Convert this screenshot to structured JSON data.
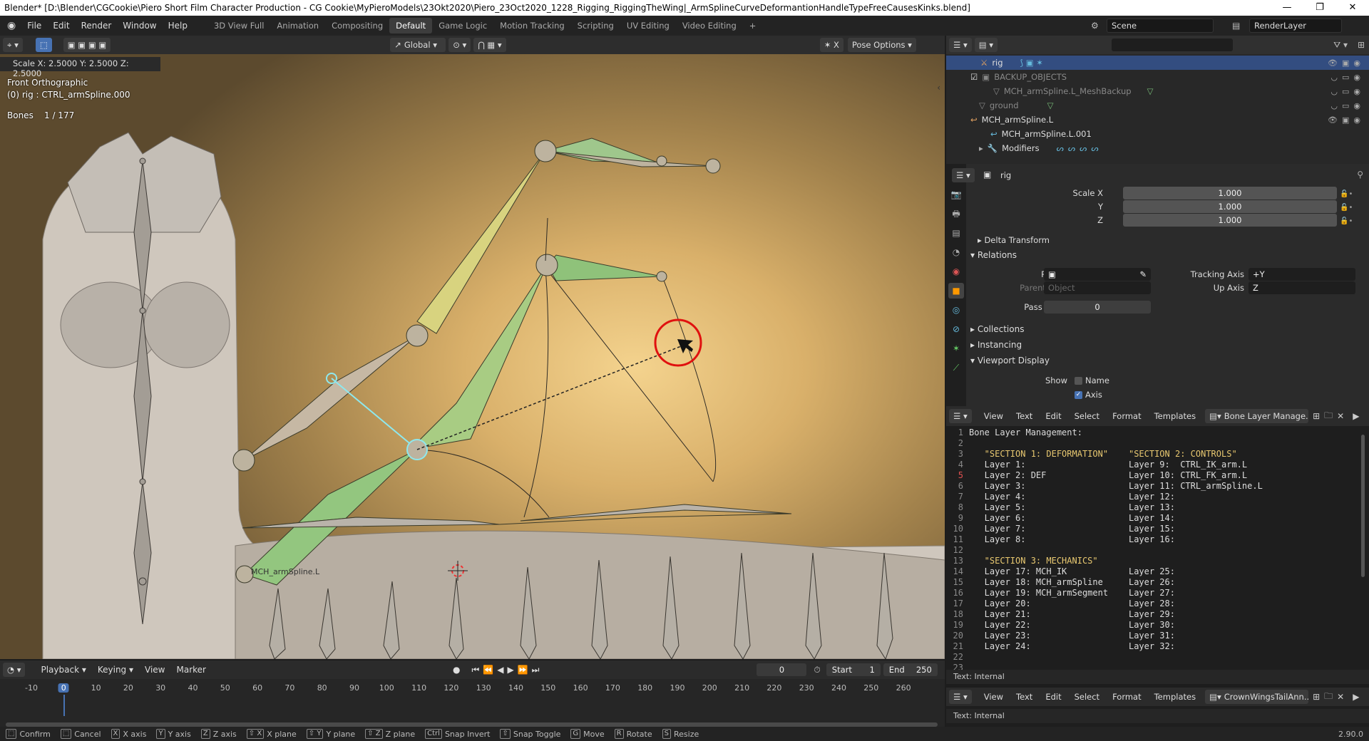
{
  "window": {
    "title": "Blender* [D:\\Blender\\CGCookie\\Piero Short Film Character Production - CG Cookie\\MyPieroModels\\23Okt2020\\Piero_23Oct2020_1228_Rigging_RiggingTheWing|_ArmSplineCurveDeformantionHandleTypeFreeCausesKinks.blend]",
    "min": "—",
    "max": "❐",
    "close": "✕"
  },
  "menus": [
    "File",
    "Edit",
    "Render",
    "Window",
    "Help"
  ],
  "workspaces": [
    "3D View Full",
    "Animation",
    "Compositing",
    "Default",
    "Game Logic",
    "Motion Tracking",
    "Scripting",
    "UV Editing",
    "Video Editing"
  ],
  "active_workspace": "Default",
  "add_tab": "+",
  "scene": "Scene",
  "view_layer": "RenderLayer",
  "viewport": {
    "orientation": "Global",
    "pose_options": "Pose Options",
    "operator_info": "Scale X: 2.5000  Y: 2.5000  Z: 2.5000",
    "view_name": "Front Orthographic",
    "object_info": "(0) rig : CTRL_armSpline.000",
    "bones_label": "Bones",
    "bones_count": "1 / 177",
    "bone_label": "MCH_armSpline.L"
  },
  "outliner": {
    "search": "",
    "rows": [
      {
        "name": "rig",
        "selected": true
      },
      {
        "name": "BACKUP_OBJECTS"
      },
      {
        "name": "MCH_armSpline.L_MeshBackup"
      },
      {
        "name": "ground"
      },
      {
        "name": "MCH_armSpline.L"
      },
      {
        "name": "MCH_armSpline.L.001"
      },
      {
        "name": "Modifiers"
      }
    ]
  },
  "properties": {
    "object_name": "rig",
    "scale_x_label": "Scale X",
    "scale_x": "1.000",
    "scale_y_label": "Y",
    "scale_y": "1.000",
    "scale_z_label": "Z",
    "scale_z": "1.000",
    "delta_transform": "Delta Transform",
    "relations": "Relations",
    "parent_label": "Parent",
    "parent_type_label": "Parent Type",
    "parent_type": "Object",
    "tracking_axis_label": "Tracking Axis",
    "tracking_axis": "+Y",
    "up_axis_label": "Up Axis",
    "up_axis": "Z",
    "pass_index_label": "Pass Index",
    "pass_index": "0",
    "collections": "Collections",
    "instancing": "Instancing",
    "viewport_display": "Viewport Display",
    "show_label": "Show",
    "name_label": "Name",
    "axis_label": "Axis"
  },
  "text_editor": {
    "menus": [
      "View",
      "Text",
      "Edit",
      "Select",
      "Format",
      "Templates"
    ],
    "file": "Bone Layer Manage...",
    "lines": [
      "Bone Layer Management:",
      "",
      "   \"SECTION 1: DEFORMATION\"    \"SECTION 2: CONTROLS\"",
      "   Layer 1:                    Layer 9:  CTRL_IK_arm.L",
      "   Layer 2: DEF                Layer 10: CTRL_FK_arm.L",
      "   Layer 3:                    Layer 11: CTRL_armSpline.L",
      "   Layer 4:                    Layer 12:",
      "   Layer 5:                    Layer 13:",
      "   Layer 6:                    Layer 14:",
      "   Layer 7:                    Layer 15:",
      "   Layer 8:                    Layer 16:",
      "",
      "   \"SECTION 3: MECHANICS\"",
      "   Layer 17: MCH_IK            Layer 25:",
      "   Layer 18: MCH_armSpline     Layer 26:",
      "   Layer 19: MCH_armSegment    Layer 27:",
      "   Layer 20:                   Layer 28:",
      "   Layer 21:                   Layer 29:",
      "   Layer 22:                   Layer 30:",
      "   Layer 23:                   Layer 31:",
      "   Layer 24:                   Layer 32:",
      "",
      ""
    ],
    "line_numbers": [
      "1",
      "2",
      "3",
      "4",
      "5",
      "6",
      "7",
      "8",
      "9",
      "10",
      "11",
      "12",
      "13",
      "14",
      "15",
      "16",
      "17",
      "18",
      "19",
      "20",
      "21",
      "22",
      "23"
    ],
    "status": "Text: Internal",
    "file2": "CrownWingsTailAnn...",
    "status2": "Text: Internal"
  },
  "timeline": {
    "menus": [
      "Playback",
      "Keying",
      "View",
      "Marker"
    ],
    "current_frame": "0",
    "start_label": "Start",
    "start": "1",
    "end_label": "End",
    "end": "250",
    "ticks": [
      "-10",
      "0",
      "10",
      "20",
      "30",
      "40",
      "50",
      "60",
      "70",
      "80",
      "90",
      "100",
      "110",
      "120",
      "130",
      "140",
      "150",
      "160",
      "170",
      "180",
      "190",
      "200",
      "210",
      "220",
      "230",
      "240",
      "250",
      "260"
    ]
  },
  "statusbar": {
    "items": [
      {
        "key": "⬚",
        "label": "Confirm"
      },
      {
        "key": "⬚",
        "label": "Cancel"
      },
      {
        "key": "X",
        "label": "X axis"
      },
      {
        "key": "Y",
        "label": "Y axis"
      },
      {
        "key": "Z",
        "label": "Z axis"
      },
      {
        "key": "⇧ X",
        "label": "X plane"
      },
      {
        "key": "⇧ Y",
        "label": "Y plane"
      },
      {
        "key": "⇧ Z",
        "label": "Z plane"
      },
      {
        "key": "Ctrl",
        "label": "Snap Invert"
      },
      {
        "key": "⇧",
        "label": "Snap Toggle"
      },
      {
        "key": "G",
        "label": "Move"
      },
      {
        "key": "R",
        "label": "Rotate"
      },
      {
        "key": "S",
        "label": "Resize"
      }
    ],
    "version": "2.90.0"
  },
  "colors": {
    "accent": "#4772b3",
    "selection": "#334d80",
    "bone_green": "#8fbf6f",
    "bone_yellow": "#d9d27a"
  }
}
